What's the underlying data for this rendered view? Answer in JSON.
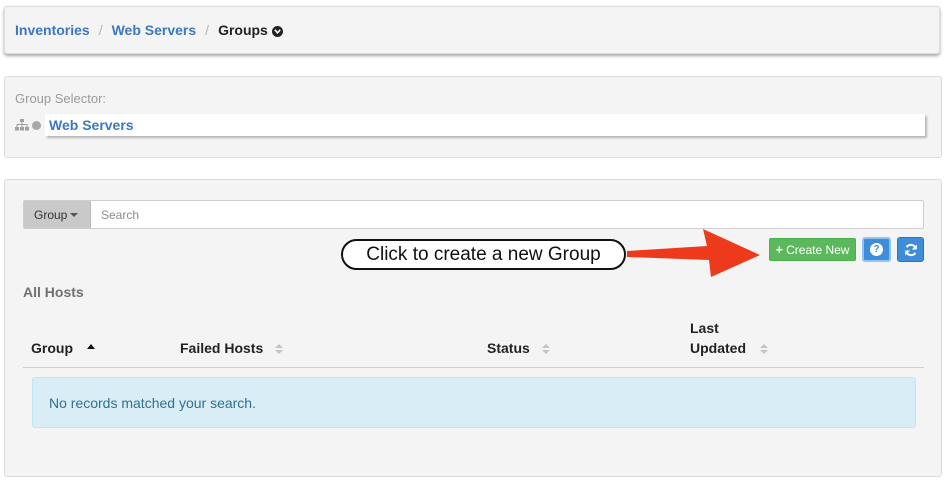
{
  "breadcrumb": {
    "items": [
      "Inventories",
      "Web Servers"
    ],
    "separator": "/",
    "current": "Groups",
    "current_icon": "chevron-down-circle-icon"
  },
  "group_selector": {
    "label": "Group Selector:",
    "tree_icon": "sitemap-icon",
    "node_icon": "circle-icon",
    "selected": "Web Servers"
  },
  "search": {
    "dropdown_label": "Group",
    "placeholder": "Search",
    "value": ""
  },
  "annotation": {
    "text": "Click to create a new Group",
    "arrow_color": "#ee3a1c"
  },
  "toolbar": {
    "create_icon": "plus-icon",
    "create_label": "Create New",
    "help_icon": "question-circle-icon",
    "refresh_icon": "refresh-icon",
    "create_color": "#5cb85c",
    "action_color": "#3e8ddb"
  },
  "hosts": {
    "title": "All Hosts",
    "columns": [
      "Group",
      "Failed Hosts",
      "Status",
      "Last Updated"
    ],
    "empty_message": "No records matched your search."
  }
}
